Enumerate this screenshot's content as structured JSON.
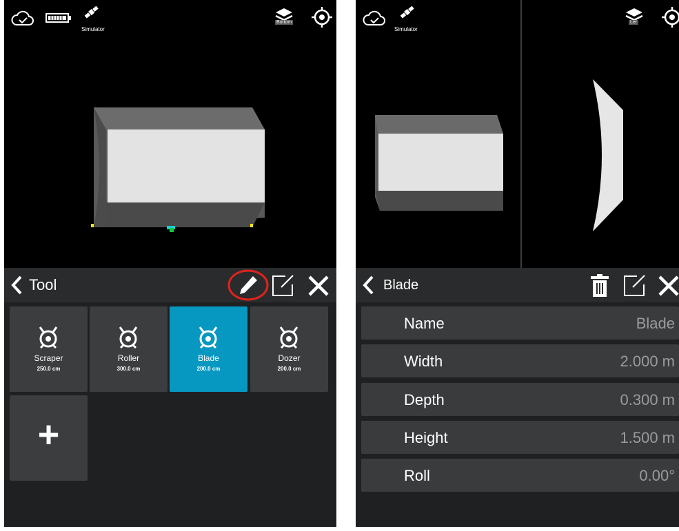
{
  "left": {
    "status": {
      "gnss_label": "Simulator",
      "view_label": "Bottom"
    },
    "panel": {
      "title": "Tool",
      "tools": [
        {
          "name": "Scraper",
          "size": "250.0 cm",
          "selected": false
        },
        {
          "name": "Roller",
          "size": "300.0 cm",
          "selected": false
        },
        {
          "name": "Blade",
          "size": "200.0 cm",
          "selected": true
        },
        {
          "name": "Dozer",
          "size": "200.0 cm",
          "selected": false
        }
      ],
      "add_label": "+"
    },
    "annotation_color": "#e0231c"
  },
  "right": {
    "status": {
      "gnss_label": "Simulator",
      "view_label": "Ler"
    },
    "panel": {
      "title": "Blade",
      "properties": [
        {
          "label": "Name",
          "value": "Blade"
        },
        {
          "label": "Width",
          "value": "2.000 m"
        },
        {
          "label": "Depth",
          "value": "0.300 m"
        },
        {
          "label": "Height",
          "value": "1.500 m"
        },
        {
          "label": "Roll",
          "value": "0.00°"
        }
      ]
    }
  },
  "colors": {
    "panel_bg": "#2a2b2d",
    "tile_bg": "#3c3d3f",
    "selected_tile": "#0798c2",
    "value_text": "#9a9b9d"
  }
}
